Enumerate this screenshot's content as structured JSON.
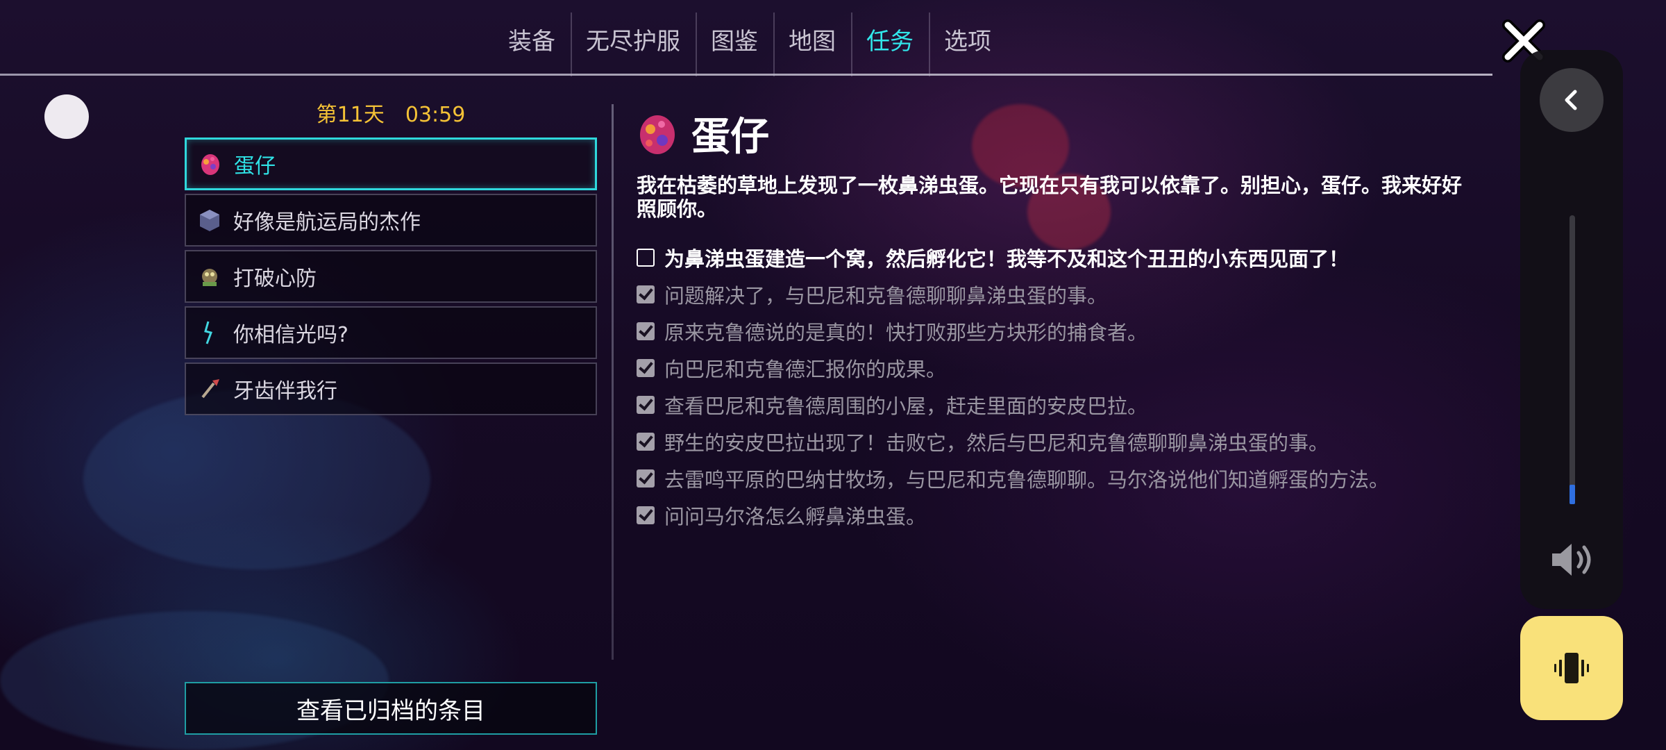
{
  "nav": {
    "tabs": [
      {
        "label": "装备",
        "active": false
      },
      {
        "label": "无尽护服",
        "active": false
      },
      {
        "label": "图鉴",
        "active": false
      },
      {
        "label": "地图",
        "active": false
      },
      {
        "label": "任务",
        "active": true
      },
      {
        "label": "选项",
        "active": false
      }
    ]
  },
  "colors": {
    "accent": "#31e6ea",
    "timer": "#f4c236",
    "vibrate_button": "#f9e17a",
    "volume_fill": "#2f6fe0"
  },
  "timer": {
    "day": "第11天",
    "time": "03:59"
  },
  "quests": [
    {
      "label": "蛋仔",
      "icon": "egg-icon",
      "active": true
    },
    {
      "label": "好像是航运局的杰作",
      "icon": "crate-icon",
      "active": false
    },
    {
      "label": "打破心防",
      "icon": "creature-icon",
      "active": false
    },
    {
      "label": "你相信光吗?",
      "icon": "lightning-icon",
      "active": false
    },
    {
      "label": "牙齿伴我行",
      "icon": "tool-icon",
      "active": false
    }
  ],
  "archive_button": "查看已归档的条目",
  "detail": {
    "title": "蛋仔",
    "description": "我在枯萎的草地上发现了一枚鼻涕虫蛋。它现在只有我可以依靠了。别担心，蛋仔。我来好好照顾你。",
    "objectives": [
      {
        "text": "为鼻涕虫蛋建造一个窝，然后孵化它！我等不及和这个丑丑的小东西见面了！",
        "done": false
      },
      {
        "text": "问题解决了，与巴尼和克鲁德聊聊鼻涕虫蛋的事。",
        "done": true
      },
      {
        "text": "原来克鲁德说的是真的！快打败那些方块形的捕食者。",
        "done": true
      },
      {
        "text": "向巴尼和克鲁德汇报你的成果。",
        "done": true
      },
      {
        "text": "查看巴尼和克鲁德周围的小屋，赶走里面的安皮巴拉。",
        "done": true
      },
      {
        "text": "野生的安皮巴拉出现了！击败它，然后与巴尼和克鲁德聊聊鼻涕虫蛋的事。",
        "done": true
      },
      {
        "text": "去雷鸣平原的巴纳甘牧场，与巴尼和克鲁德聊聊。马尔洛说他们知道孵蛋的方法。",
        "done": true
      },
      {
        "text": "问问马尔洛怎么孵鼻涕虫蛋。",
        "done": true
      }
    ]
  },
  "system_overlay": {
    "volume_level": 0.07,
    "icons": [
      "back-chevron-icon",
      "volume-icon",
      "vibrate-icon"
    ]
  }
}
